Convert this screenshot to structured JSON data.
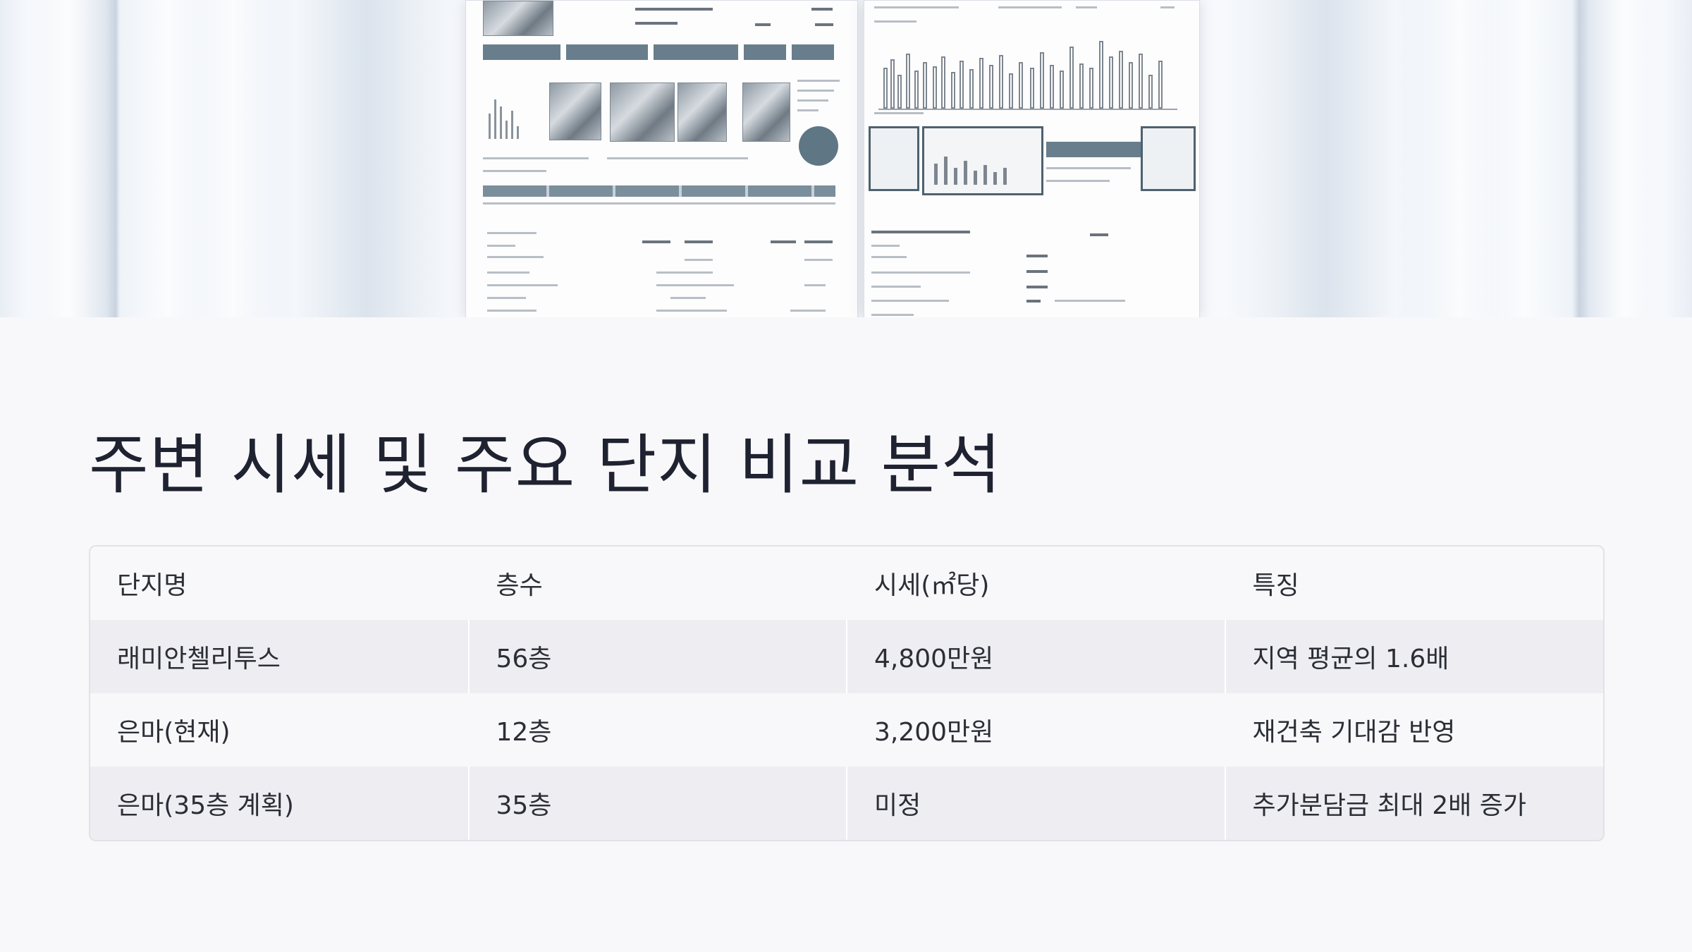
{
  "slide": {
    "title": "주변 시세 및 주요 단지 비교 분석"
  },
  "table": {
    "headers": [
      "단지명",
      "층수",
      "시세(㎡당)",
      "특징"
    ],
    "rows": [
      [
        "래미안첼리투스",
        "56층",
        "4,800만원",
        "지역 평균의 1.6배"
      ],
      [
        "은마(현재)",
        "12층",
        "3,200만원",
        "재건축 기대감 반영"
      ],
      [
        "은마(35층 계획)",
        "35층",
        "미정",
        "추가분담금 최대 2배 증가"
      ]
    ]
  },
  "colors": {
    "background": "#f8f8fb",
    "title_text": "#1f2230",
    "table_text": "#2c2e36",
    "row_shade": "#eeeef2",
    "border": "#e1e2e8",
    "accent_slate": "#687e8c"
  }
}
